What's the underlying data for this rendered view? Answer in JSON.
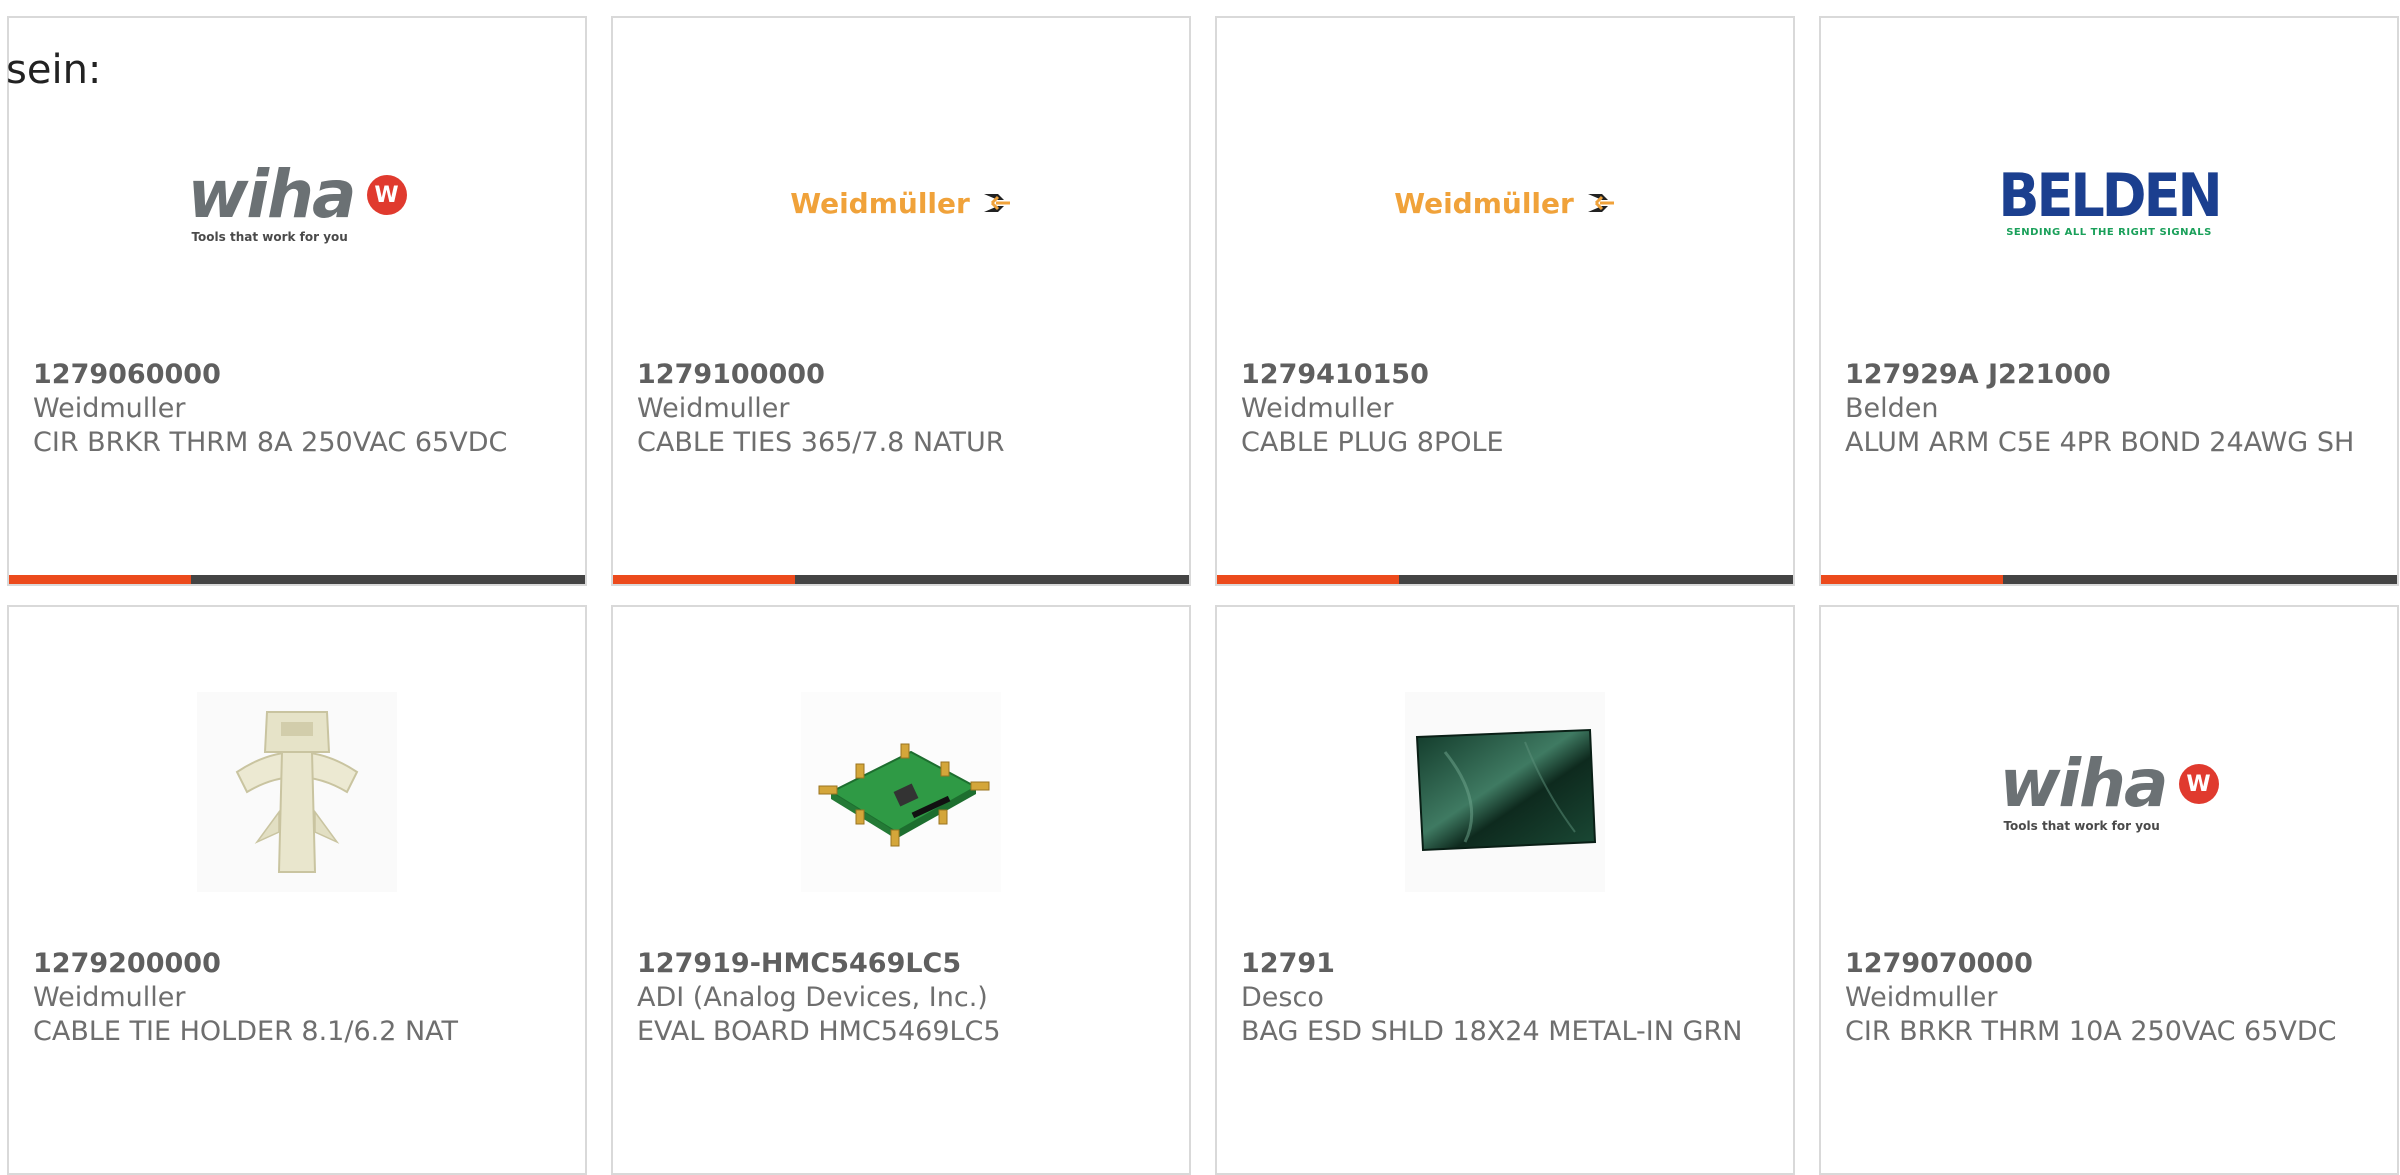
{
  "intro_text": "sein:",
  "colors": {
    "accent": "#ec4a1c",
    "bar": "#444444",
    "border": "#d9d9d9",
    "text": "#6e6e6e"
  },
  "logos": {
    "wiha": {
      "word": "wiha",
      "badge": "W",
      "tag": "Tools that work for you"
    },
    "weidmuller": {
      "word": "Weidmüller"
    },
    "belden": {
      "word": "BELDEN",
      "tag": "SENDING ALL THE RIGHT SIGNALS"
    }
  },
  "products": [
    {
      "part_number": "1279060000",
      "manufacturer": "Weidmuller",
      "description": "CIR BRKR THRM 8A 250VAC 65VDC",
      "image": "wiha-logo"
    },
    {
      "part_number": "1279100000",
      "manufacturer": "Weidmuller",
      "description": "CABLE TIES 365/7.8 NATUR",
      "image": "weidmuller-logo"
    },
    {
      "part_number": "1279410150",
      "manufacturer": "Weidmuller",
      "description": "CABLE PLUG 8POLE",
      "image": "weidmuller-logo"
    },
    {
      "part_number": "127929A J221000",
      "manufacturer": "Belden",
      "description": "ALUM ARM C5E 4PR BOND 24AWG SH",
      "image": "belden-logo"
    },
    {
      "part_number": "1279200000",
      "manufacturer": "Weidmuller",
      "description": "CABLE TIE HOLDER 8.1/6.2 NAT",
      "image": "cable-tie-holder-photo"
    },
    {
      "part_number": "127919-HMC5469LC5",
      "manufacturer": "ADI (Analog Devices, Inc.)",
      "description": "EVAL BOARD HMC5469LC5",
      "image": "eval-board-photo"
    },
    {
      "part_number": "12791",
      "manufacturer": "Desco",
      "description": "BAG ESD SHLD 18X24 METAL-IN GRN",
      "image": "esd-bag-photo"
    },
    {
      "part_number": "1279070000",
      "manufacturer": "Weidmuller",
      "description": "CIR BRKR THRM 10A 250VAC 65VDC",
      "image": "wiha-logo"
    }
  ]
}
